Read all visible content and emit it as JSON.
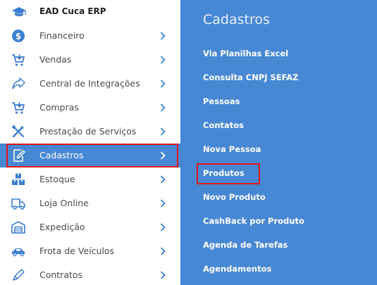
{
  "brand": {
    "title": "EAD Cuca ERP",
    "icon": "graduation-cap-icon"
  },
  "menu": {
    "items": [
      {
        "label": "Financeiro",
        "icon": "dollar-icon"
      },
      {
        "label": "Vendas",
        "icon": "cart-icon"
      },
      {
        "label": "Central de Integrações",
        "icon": "share-arrow-icon"
      },
      {
        "label": "Compras",
        "icon": "cart-download-icon"
      },
      {
        "label": "Prestação de Serviços",
        "icon": "tools-icon"
      },
      {
        "label": "Cadastros",
        "icon": "edit-document-icon",
        "active": true
      },
      {
        "label": "Estoque",
        "icon": "boxes-icon"
      },
      {
        "label": "Loja Online",
        "icon": "truck-icon"
      },
      {
        "label": "Expedição",
        "icon": "warehouse-icon"
      },
      {
        "label": "Frota de Veículos",
        "icon": "car-icon"
      },
      {
        "label": "Contratos",
        "icon": "pen-icon"
      }
    ]
  },
  "submenu": {
    "title": "Cadastros",
    "items": [
      "Via Planilhas Excel",
      "Consulta CNPJ SEFAZ",
      "Pessoas",
      "Contatos",
      "Nova Pessoa",
      "Produtos",
      "Novo Produto",
      "CashBack por Produto",
      "Agenda de Tarefas",
      "Agendamentos"
    ]
  },
  "colors": {
    "accent": "#4788d4",
    "icon": "#3d7fd0",
    "highlight": "#e2161b"
  }
}
